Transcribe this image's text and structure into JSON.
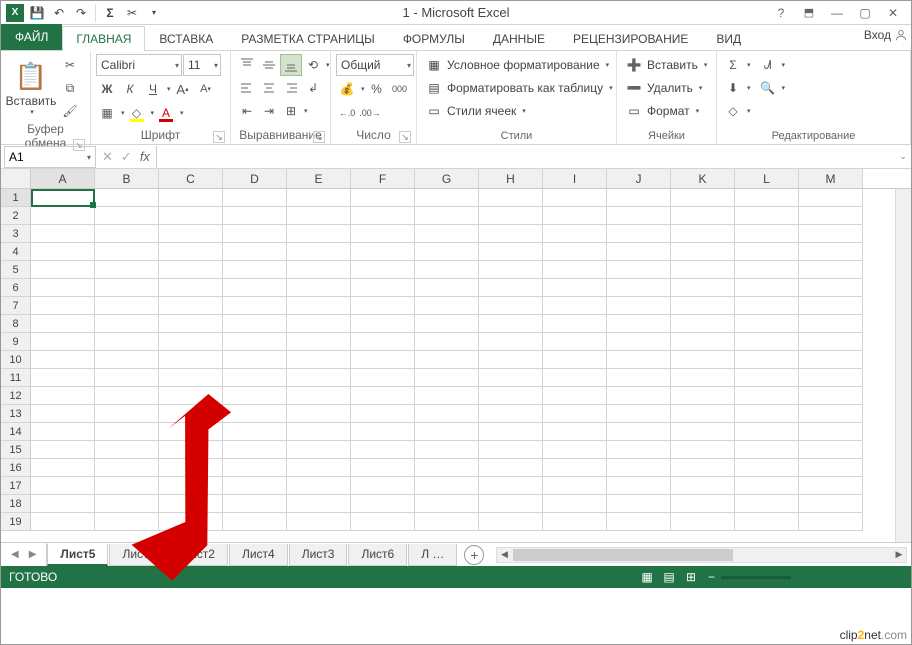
{
  "title": "1 - Microsoft Excel",
  "tabs": {
    "file": "ФАЙЛ",
    "list": [
      "ГЛАВНАЯ",
      "ВСТАВКА",
      "РАЗМЕТКА СТРАНИЦЫ",
      "ФОРМУЛЫ",
      "ДАННЫЕ",
      "РЕЦЕНЗИРОВАНИЕ",
      "ВИД"
    ],
    "login": "Вход"
  },
  "ribbon": {
    "clipboard": {
      "paste": "Вставить",
      "label": "Буфер обмена"
    },
    "font": {
      "name": "Calibri",
      "size": "11",
      "label": "Шрифт",
      "bold": "Ж",
      "italic": "К",
      "underline": "Ч",
      "aup": "A",
      "adown": "A"
    },
    "align": {
      "label": "Выравнивание"
    },
    "number": {
      "format": "Общий",
      "label": "Число",
      "decplus": ".0",
      "decminus": ".00"
    },
    "styles": {
      "cond": "Условное форматирование",
      "table": "Форматировать как таблицу",
      "cell": "Стили ячеек",
      "label": "Стили"
    },
    "cells": {
      "insert": "Вставить",
      "delete": "Удалить",
      "format": "Формат",
      "label": "Ячейки"
    },
    "edit": {
      "label": "Редактирование"
    }
  },
  "namebox": "A1",
  "columns": [
    "A",
    "B",
    "C",
    "D",
    "E",
    "F",
    "G",
    "H",
    "I",
    "J",
    "K",
    "L",
    "M"
  ],
  "rows": 19,
  "sheets": [
    "Лист5",
    "Лист1",
    "Лист2",
    "Лист4",
    "Лист3",
    "Лист6",
    "Л …"
  ],
  "status": "ГОТОВО",
  "watermark": {
    "a": "clip",
    "b": "2",
    "c": "net",
    "d": ".com"
  }
}
